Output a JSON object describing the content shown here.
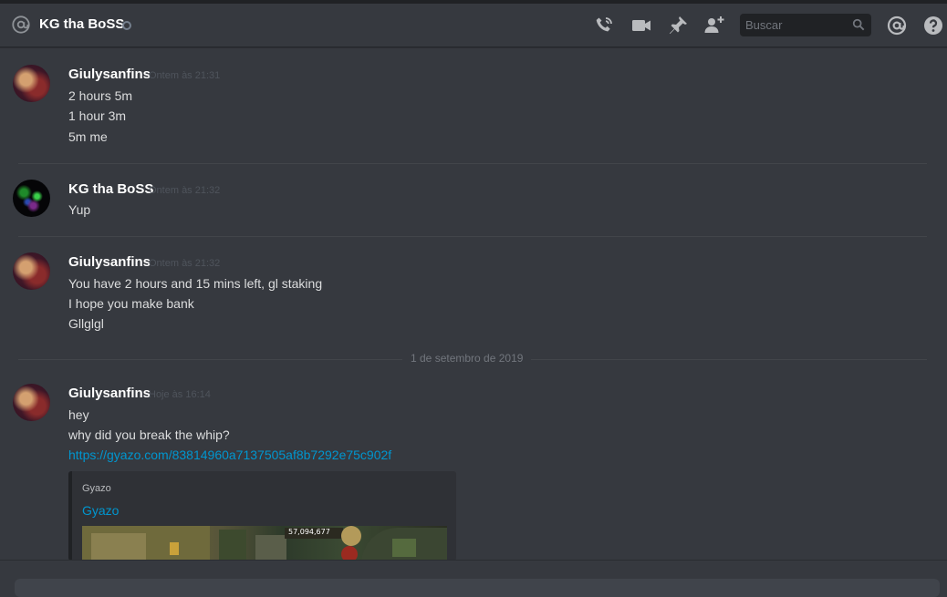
{
  "header": {
    "title": "KG tha BoSS",
    "search_placeholder": "Buscar"
  },
  "messages": [
    {
      "author": "Giulysanfins",
      "time": "Ontem às 21:31",
      "lines": [
        "2 hours 5m",
        "1 hour 3m",
        "5m me"
      ]
    },
    {
      "author": "KG tha BoSS",
      "time": "Ontem às 21:32",
      "lines": [
        "Yup"
      ]
    },
    {
      "author": "Giulysanfins",
      "time": "Ontem às 21:32",
      "lines": [
        "You have 2 hours and 15 mins left, gl staking",
        "I hope you make bank",
        "Gllglgl"
      ]
    },
    {
      "author": "Giulysanfins",
      "time": "Hoje às 16:14",
      "lines": [
        "hey",
        "why did you break the whip?"
      ],
      "link": "https://gyazo.com/83814960a7137505af8b7292e75c902f"
    }
  ],
  "date_divider": "1 de setembro de 2019",
  "embed": {
    "provider": "Gyazo",
    "title": "Gyazo",
    "image_text": "57,094,677"
  },
  "colors": {
    "background": "#36393f",
    "header_text": "#ffffff",
    "link": "#0096cf",
    "timestamp": "#4f545c"
  }
}
